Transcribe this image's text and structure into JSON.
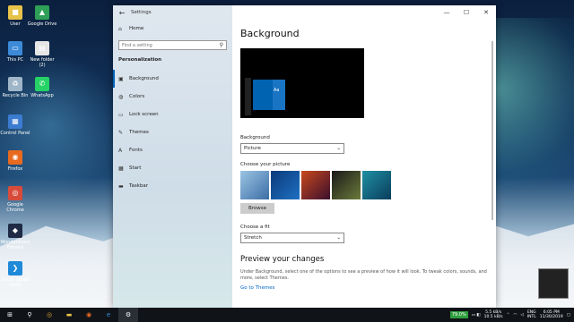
{
  "desktop": {
    "icons": [
      {
        "label": "User",
        "icon": "user-folder-icon",
        "color": "#e8c34a",
        "glyph": "■"
      },
      {
        "label": "Google Drive",
        "icon": "google-drive-icon",
        "color": "#2e9f57",
        "glyph": "▲"
      },
      {
        "label": "This PC",
        "icon": "computer-icon",
        "color": "#3c8ad8",
        "glyph": "▭"
      },
      {
        "label": "New folder (2)",
        "icon": "document-icon",
        "color": "#e6e6e6",
        "glyph": "▤"
      },
      {
        "label": "Recycle Bin",
        "icon": "recycle-bin-icon",
        "color": "#9fb6c8",
        "glyph": "♻"
      },
      {
        "label": "WhatsApp",
        "icon": "whatsapp-icon",
        "color": "#25d366",
        "glyph": "✆"
      },
      {
        "label": "Control Panel",
        "icon": "control-panel-icon",
        "color": "#3b7bd0",
        "glyph": "▦"
      },
      {
        "label": "Firefox",
        "icon": "firefox-icon",
        "color": "#e76a1f",
        "glyph": "◉"
      },
      {
        "label": "Google Chrome",
        "icon": "chrome-icon",
        "color": "#d84b3a",
        "glyph": "◎"
      },
      {
        "label": "Wondershare Filmora",
        "icon": "filmora-icon",
        "color": "#1f2a44",
        "glyph": "◆"
      },
      {
        "label": "Visual Studio Code",
        "icon": "vscode-icon",
        "color": "#1f8ad8",
        "glyph": "❯"
      }
    ]
  },
  "window": {
    "title": "Settings",
    "back_glyph": "←",
    "controls": {
      "minimize": "—",
      "maximize": "☐",
      "close": "✕"
    }
  },
  "sidebar": {
    "home_label": "Home",
    "search_placeholder": "Find a setting",
    "section_title": "Personalization",
    "items": [
      {
        "label": "Background",
        "icon": "picture-icon",
        "glyph": "▣"
      },
      {
        "label": "Colors",
        "icon": "palette-icon",
        "glyph": "◍"
      },
      {
        "label": "Lock screen",
        "icon": "lock-screen-icon",
        "glyph": "▭"
      },
      {
        "label": "Themes",
        "icon": "brush-icon",
        "glyph": "✎"
      },
      {
        "label": "Fonts",
        "icon": "fonts-icon",
        "glyph": "A"
      },
      {
        "label": "Start",
        "icon": "start-icon",
        "glyph": "▦"
      },
      {
        "label": "Taskbar",
        "icon": "taskbar-icon",
        "glyph": "▬"
      }
    ]
  },
  "main": {
    "title": "Background",
    "preview_text": "Aa",
    "background_label": "Background",
    "background_value": "Picture",
    "choose_picture_label": "Choose your picture",
    "thumb_colors": [
      [
        "#9cc4e4",
        "#3b6ea5"
      ],
      [
        "#0b3b7a",
        "#1f6fc2"
      ],
      [
        "#c9481c",
        "#3a0f2e"
      ],
      [
        "#1a1a1a",
        "#6b7a3a"
      ],
      [
        "#1e8fa3",
        "#0b3d5c"
      ]
    ],
    "browse_label": "Browse",
    "fit_label": "Choose a fit",
    "fit_value": "Stretch",
    "preview_changes_title": "Preview your changes",
    "preview_changes_desc": "Under Background, select one of the options to see a preview of how it will look. To tweak colors, sounds, and more, select Themes.",
    "go_to_themes": "Go to Themes"
  },
  "taskbar": {
    "battery": "79.0%",
    "net_up": "5.5 kB/s",
    "net_down": "10.5 kB/s",
    "lang_top": "ENG",
    "lang_bottom": "INTL",
    "time": "6:05 PM",
    "date": "11/30/2019"
  }
}
